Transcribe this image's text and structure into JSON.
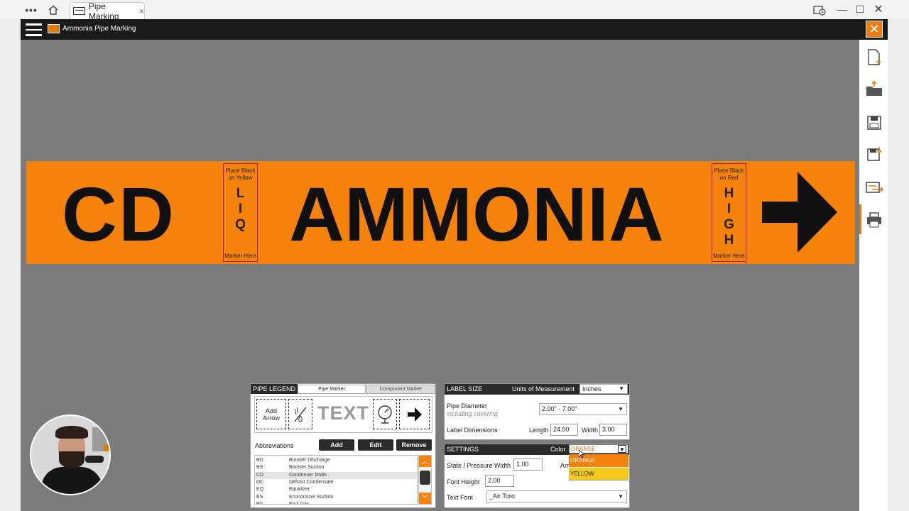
{
  "browser": {
    "menu_icon": "more-dots-icon",
    "home_icon": "home-icon",
    "tab_icon": "pipe-icon",
    "tab_title": "Pipe Marking",
    "tab_close": "×"
  },
  "app": {
    "title": "Ammonia Pipe Marking",
    "close_label": "✕"
  },
  "marker": {
    "color": "#f5820a",
    "abbreviation": "CD",
    "legend": "AMMONIA",
    "left_tag": {
      "top": [
        "Place Black",
        "on Yellow"
      ],
      "letters": [
        "L",
        "I",
        "Q"
      ],
      "bottom": "Marker Here"
    },
    "right_tag": {
      "top": [
        "Place Black",
        "on Red"
      ],
      "letters": [
        "H",
        "I",
        "G",
        "H"
      ],
      "bottom": "Marker Here"
    },
    "arrow": "➔"
  },
  "toolbar": [
    "new-file-icon",
    "open-folder-icon",
    "save-icon",
    "save-as-icon",
    "export-icon",
    "print-icon"
  ],
  "pipe_legend": {
    "title": "PIPE LEGEND",
    "tabs": [
      "Pipe Marker",
      "Component Marker"
    ],
    "add_arrow": [
      "Add",
      "Arrow"
    ],
    "text_label": "TEXT",
    "abbreviations_label": "Abbreviations",
    "buttons": {
      "add": "Add",
      "edit": "Edit",
      "remove": "Remove"
    },
    "rows": [
      {
        "code": "BD",
        "name": "Booster Discharge"
      },
      {
        "code": "BS",
        "name": "Booster Suction"
      },
      {
        "code": "CD",
        "name": "Condenser Drain"
      },
      {
        "code": "DC",
        "name": "Defrost Condensate"
      },
      {
        "code": "EQ",
        "name": "Equalizer"
      },
      {
        "code": "ES",
        "name": "Economizer Suction"
      },
      {
        "code": "FG",
        "name": "Foul Gas"
      }
    ],
    "selected_row": 2
  },
  "label_size": {
    "title": "LABEL SIZE",
    "units_label": "Units of Measurement",
    "units_value": "Inches",
    "pipe_diameter_label": "Pipe Diameter",
    "pipe_diameter_sub": "including covering",
    "pipe_diameter_value": "2.00\" - 7.00\"",
    "dimensions_label": "Label Dimensions",
    "length_label": "Length",
    "length_value": "24.00",
    "width_label": "Width",
    "width_value": "3.00"
  },
  "settings": {
    "title": "SETTINGS",
    "color_label": "Color",
    "color_value": "ORANGE",
    "color_options": [
      "ORANGE",
      "YELLOW"
    ],
    "state_label": "State / Pressure Width",
    "state_value": "1.00",
    "arrow_label": "Arr",
    "font_height_label": "Font Height",
    "font_height_value": "2.00",
    "text_font_label": "Text Font",
    "text_font_value": "_Air Toro"
  }
}
